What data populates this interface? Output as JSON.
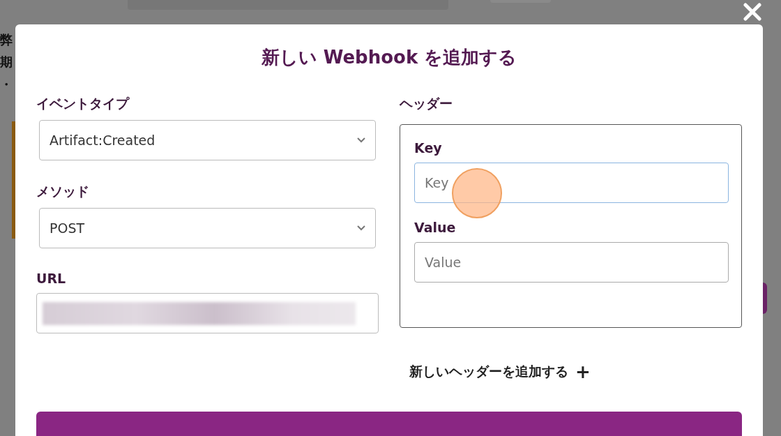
{
  "background_page": {
    "texts": [
      "弊",
      "期",
      "・"
    ]
  },
  "dialog": {
    "title": "新しい Webhook を追加する",
    "left_fields": [
      {
        "kind": "select",
        "label": "イベントタイプ",
        "value": "Artifact:Created"
      },
      {
        "kind": "select",
        "label": "メソッド",
        "value": "POST"
      },
      {
        "kind": "redacted",
        "label": "URL"
      }
    ],
    "headers": {
      "label": "ヘッダー",
      "fields": [
        {
          "label": "Key",
          "placeholder": "Key",
          "focused": true
        },
        {
          "label": "Value",
          "placeholder": "Value",
          "focused": false
        }
      ],
      "add_link": "新しいヘッダーを追加する",
      "add_icon": "+"
    }
  }
}
